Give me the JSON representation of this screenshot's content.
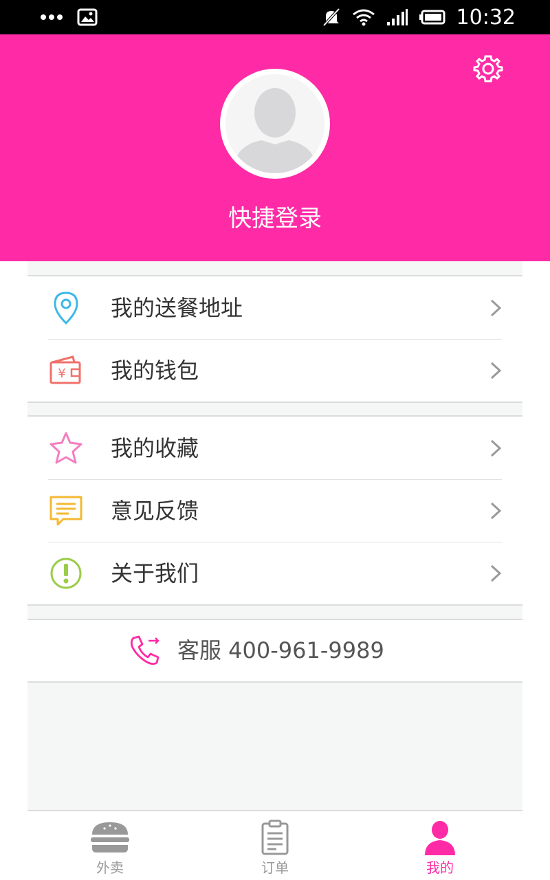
{
  "status_bar": {
    "time": "10:32"
  },
  "header": {
    "background": "#ff2aa6",
    "login_label": "快捷登录",
    "settings_icon": "gear-icon",
    "avatar_icon": "default-avatar-icon"
  },
  "menu": {
    "group1": [
      {
        "label": "我的送餐地址",
        "icon": "location-pin-icon",
        "icon_color": "#3db8e8"
      },
      {
        "label": "我的钱包",
        "icon": "wallet-icon",
        "icon_color": "#f0706a"
      }
    ],
    "group2": [
      {
        "label": "我的收藏",
        "icon": "star-icon",
        "icon_color": "#f47fbf"
      },
      {
        "label": "意见反馈",
        "icon": "feedback-icon",
        "icon_color": "#f5b932"
      },
      {
        "label": "关于我们",
        "icon": "info-icon",
        "icon_color": "#9ccc4a"
      }
    ]
  },
  "service": {
    "label": "客服 400-961-9989",
    "icon": "phone-icon",
    "icon_color": "#ff2aa6"
  },
  "bottom_nav": {
    "items": [
      {
        "label": "外卖",
        "icon": "burger-icon",
        "active": false
      },
      {
        "label": "订单",
        "icon": "order-list-icon",
        "active": false
      },
      {
        "label": "我的",
        "icon": "user-icon",
        "active": true
      }
    ],
    "active_color": "#ff2aa6"
  }
}
